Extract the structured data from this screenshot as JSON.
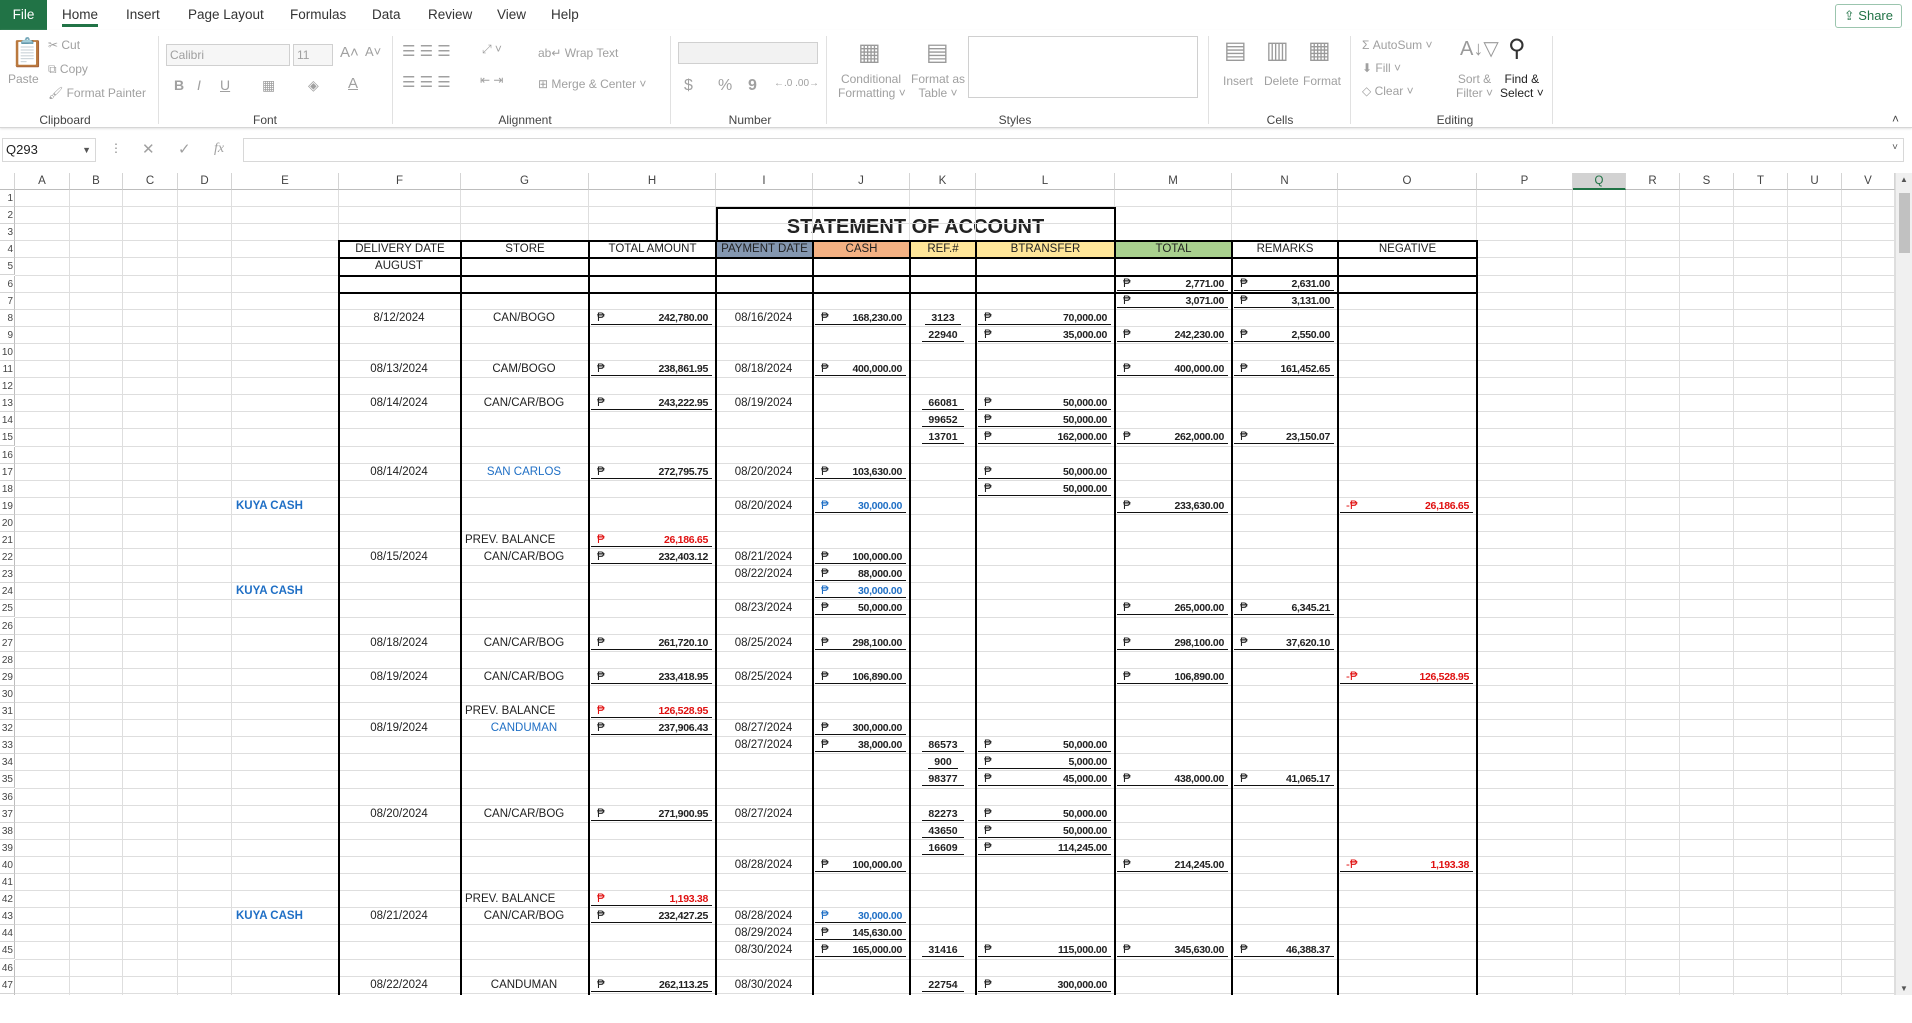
{
  "tabs": {
    "file": "File",
    "items": [
      "Home",
      "Insert",
      "Page Layout",
      "Formulas",
      "Data",
      "Review",
      "View",
      "Help"
    ],
    "active": "Home",
    "share": "Share"
  },
  "ribbon": {
    "clipboard": {
      "paste": "Paste",
      "cut": "Cut",
      "copy": "Copy",
      "format_painter": "Format Painter",
      "label": "Clipboard"
    },
    "font": {
      "name": "Calibri",
      "size": "11",
      "bold": "B",
      "italic": "I",
      "underline": "U",
      "label": "Font"
    },
    "alignment": {
      "wrap": "Wrap Text",
      "merge": "Merge & Center",
      "label": "Alignment"
    },
    "number": {
      "label": "Number",
      "dollar": "$",
      "percent": "%",
      "comma": "9"
    },
    "styles": {
      "conditional": "Conditional",
      "conditional2": "Formatting",
      "format_table": "Format as",
      "format_table2": "Table",
      "label": "Styles"
    },
    "cells": {
      "insert": "Insert",
      "delete": "Delete",
      "format": "Format",
      "label": "Cells"
    },
    "editing": {
      "autosum": "AutoSum",
      "fill": "Fill",
      "clear": "Clear",
      "sort": "Sort &",
      "sort2": "Filter",
      "find": "Find &",
      "find2": "Select",
      "label": "Editing"
    }
  },
  "formula_bar": {
    "name_box": "Q293",
    "fx": "fx",
    "value": ""
  },
  "sheet": {
    "selected_column": "Q",
    "columns": [
      "A",
      "B",
      "C",
      "D",
      "E",
      "F",
      "G",
      "H",
      "I",
      "J",
      "K",
      "L",
      "M",
      "N",
      "O",
      "P",
      "Q",
      "R",
      "S",
      "T",
      "U",
      "V"
    ],
    "title": "STATEMENT OF ACCOUNT",
    "headers": {
      "F": "DELIVERY DATE",
      "G": "STORE",
      "H": "TOTAL AMOUNT",
      "I": "PAYMENT DATE",
      "J": "CASH",
      "K": "REF.#",
      "L": "BTRANSFER",
      "M": "TOTAL",
      "N": "REMARKS",
      "O": "NEGATIVE"
    },
    "header_colors": {
      "I": "#8497b0",
      "J": "#f4b183",
      "K": "#ffe699",
      "L": "#ffe699",
      "M": "#a9d08e"
    },
    "rows": [
      {
        "row": 5,
        "cells": {
          "F": "AUGUST"
        }
      },
      {
        "row": 6,
        "cells": {
          "M": {
            "cur": "₱",
            "amt": "2,771.00"
          },
          "N": {
            "cur": "₱",
            "amt": "2,631.00"
          }
        }
      },
      {
        "row": 7,
        "cells": {
          "M": {
            "cur": "₱",
            "amt": "3,071.00"
          },
          "N": {
            "cur": "₱",
            "amt": "3,131.00"
          }
        }
      },
      {
        "row": 8,
        "cells": {
          "F": "8/12/2024",
          "G": "CAN/BOGO",
          "H": {
            "cur": "₱",
            "amt": "242,780.00"
          },
          "I": "08/16/2024",
          "J": {
            "cur": "₱",
            "amt": "168,230.00"
          },
          "K": {
            "ref": "3123"
          },
          "L": {
            "cur": "₱",
            "amt": "70,000.00"
          }
        }
      },
      {
        "row": 9,
        "cells": {
          "K": {
            "ref": "22940"
          },
          "L": {
            "cur": "₱",
            "amt": "35,000.00"
          },
          "M": {
            "cur": "₱",
            "amt": "242,230.00"
          },
          "N": {
            "cur": "₱",
            "amt": "2,550.00"
          }
        }
      },
      {
        "row": 11,
        "cells": {
          "F": "08/13/2024",
          "G": "CAM/BOGO",
          "H": {
            "cur": "₱",
            "amt": "238,861.95"
          },
          "I": "08/18/2024",
          "J": {
            "cur": "₱",
            "amt": "400,000.00"
          },
          "M": {
            "cur": "₱",
            "amt": "400,000.00"
          },
          "N": {
            "cur": "₱",
            "amt": "161,452.65"
          }
        }
      },
      {
        "row": 13,
        "cells": {
          "F": "08/14/2024",
          "G": "CAN/CAR/BOG",
          "H": {
            "cur": "₱",
            "amt": "243,222.95"
          },
          "I": "08/19/2024",
          "K": {
            "ref": "66081"
          },
          "L": {
            "cur": "₱",
            "amt": "50,000.00"
          }
        }
      },
      {
        "row": 14,
        "cells": {
          "K": {
            "ref": "99652"
          },
          "L": {
            "cur": "₱",
            "amt": "50,000.00"
          }
        }
      },
      {
        "row": 15,
        "cells": {
          "K": {
            "ref": "13701"
          },
          "L": {
            "cur": "₱",
            "amt": "162,000.00"
          },
          "M": {
            "cur": "₱",
            "amt": "262,000.00"
          },
          "N": {
            "cur": "₱",
            "amt": "23,150.07"
          }
        }
      },
      {
        "row": 17,
        "cells": {
          "F": "08/14/2024",
          "G": {
            "text": "SAN CARLOS",
            "color": "blue"
          },
          "H": {
            "cur": "₱",
            "amt": "272,795.75"
          },
          "I": "08/20/2024",
          "J": {
            "cur": "₱",
            "amt": "103,630.00"
          },
          "L": {
            "cur": "₱",
            "amt": "50,000.00"
          }
        }
      },
      {
        "row": 18,
        "cells": {
          "L": {
            "cur": "₱",
            "amt": "50,000.00"
          }
        }
      },
      {
        "row": 19,
        "cells": {
          "E": {
            "text": "KUYA CASH",
            "color": "blue",
            "align": "left"
          },
          "I": "08/20/2024",
          "J": {
            "cur": "₱",
            "amt": "30,000.00",
            "color": "blue"
          },
          "M": {
            "cur": "₱",
            "amt": "233,630.00"
          },
          "O": {
            "cur": "-₱",
            "amt": "26,186.65",
            "color": "red"
          }
        }
      },
      {
        "row": 21,
        "cells": {
          "G": {
            "text": "PREV. BALANCE",
            "align": "left"
          },
          "H": {
            "cur": "₱",
            "amt": "26,186.65",
            "color": "red"
          }
        }
      },
      {
        "row": 22,
        "cells": {
          "F": "08/15/2024",
          "G": "CAN/CAR/BOG",
          "H": {
            "cur": "₱",
            "amt": "232,403.12"
          },
          "I": "08/21/2024",
          "J": {
            "cur": "₱",
            "amt": "100,000.00"
          }
        }
      },
      {
        "row": 23,
        "cells": {
          "I": "08/22/2024",
          "J": {
            "cur": "₱",
            "amt": "88,000.00"
          }
        }
      },
      {
        "row": 24,
        "cells": {
          "E": {
            "text": "KUYA CASH",
            "color": "blue",
            "align": "left"
          },
          "J": {
            "cur": "₱",
            "amt": "30,000.00",
            "color": "blue"
          }
        }
      },
      {
        "row": 25,
        "cells": {
          "I": "08/23/2024",
          "J": {
            "cur": "₱",
            "amt": "50,000.00"
          },
          "M": {
            "cur": "₱",
            "amt": "265,000.00"
          },
          "N": {
            "cur": "₱",
            "amt": "6,345.21"
          }
        }
      },
      {
        "row": 27,
        "cells": {
          "F": "08/18/2024",
          "G": "CAN/CAR/BOG",
          "H": {
            "cur": "₱",
            "amt": "261,720.10"
          },
          "I": "08/25/2024",
          "J": {
            "cur": "₱",
            "amt": "298,100.00"
          },
          "M": {
            "cur": "₱",
            "amt": "298,100.00"
          },
          "N": {
            "cur": "₱",
            "amt": "37,620.10"
          }
        }
      },
      {
        "row": 29,
        "cells": {
          "F": "08/19/2024",
          "G": "CAN/CAR/BOG",
          "H": {
            "cur": "₱",
            "amt": "233,418.95"
          },
          "I": "08/25/2024",
          "J": {
            "cur": "₱",
            "amt": "106,890.00"
          },
          "M": {
            "cur": "₱",
            "amt": "106,890.00"
          },
          "O": {
            "cur": "-₱",
            "amt": "126,528.95",
            "color": "red"
          }
        }
      },
      {
        "row": 31,
        "cells": {
          "G": {
            "text": "PREV. BALANCE",
            "align": "left"
          },
          "H": {
            "cur": "₱",
            "amt": "126,528.95",
            "color": "red"
          }
        }
      },
      {
        "row": 32,
        "cells": {
          "F": "08/19/2024",
          "G": {
            "text": "CANDUMAN",
            "color": "blue"
          },
          "H": {
            "cur": "₱",
            "amt": "237,906.43"
          },
          "I": "08/27/2024",
          "J": {
            "cur": "₱",
            "amt": "300,000.00"
          }
        }
      },
      {
        "row": 33,
        "cells": {
          "I": "08/27/2024",
          "J": {
            "cur": "₱",
            "amt": "38,000.00"
          },
          "K": {
            "ref": "86573"
          },
          "L": {
            "cur": "₱",
            "amt": "50,000.00"
          }
        }
      },
      {
        "row": 34,
        "cells": {
          "K": {
            "ref": "900"
          },
          "L": {
            "cur": "₱",
            "amt": "5,000.00"
          }
        }
      },
      {
        "row": 35,
        "cells": {
          "K": {
            "ref": "98377"
          },
          "L": {
            "cur": "₱",
            "amt": "45,000.00"
          },
          "M": {
            "cur": "₱",
            "amt": "438,000.00"
          },
          "N": {
            "cur": "₱",
            "amt": "41,065.17"
          }
        }
      },
      {
        "row": 37,
        "cells": {
          "F": "08/20/2024",
          "G": "CAN/CAR/BOG",
          "H": {
            "cur": "₱",
            "amt": "271,900.95"
          },
          "I": "08/27/2024",
          "K": {
            "ref": "82273"
          },
          "L": {
            "cur": "₱",
            "amt": "50,000.00"
          }
        }
      },
      {
        "row": 38,
        "cells": {
          "K": {
            "ref": "43650"
          },
          "L": {
            "cur": "₱",
            "amt": "50,000.00"
          }
        }
      },
      {
        "row": 39,
        "cells": {
          "K": {
            "ref": "16609"
          },
          "L": {
            "cur": "₱",
            "amt": "114,245.00"
          }
        }
      },
      {
        "row": 40,
        "cells": {
          "I": "08/28/2024",
          "J": {
            "cur": "₱",
            "amt": "100,000.00"
          },
          "M": {
            "cur": "₱",
            "amt": "214,245.00"
          },
          "O": {
            "cur": "-₱",
            "amt": "1,193.38",
            "color": "red"
          }
        }
      },
      {
        "row": 42,
        "cells": {
          "G": {
            "text": "PREV. BALANCE",
            "align": "left"
          },
          "H": {
            "cur": "₱",
            "amt": "1,193.38",
            "color": "red"
          }
        }
      },
      {
        "row": 43,
        "cells": {
          "E": {
            "text": "KUYA CASH",
            "color": "blue",
            "align": "left"
          },
          "F": "08/21/2024",
          "G": "CAN/CAR/BOG",
          "H": {
            "cur": "₱",
            "amt": "232,427.25"
          },
          "I": "08/28/2024",
          "J": {
            "cur": "₱",
            "amt": "30,000.00",
            "color": "blue"
          }
        }
      },
      {
        "row": 44,
        "cells": {
          "I": "08/29/2024",
          "J": {
            "cur": "₱",
            "amt": "145,630.00"
          }
        }
      },
      {
        "row": 45,
        "cells": {
          "I": "08/30/2024",
          "J": {
            "cur": "₱",
            "amt": "165,000.00"
          },
          "K": {
            "ref": "31416"
          },
          "L": {
            "cur": "₱",
            "amt": "115,000.00"
          },
          "M": {
            "cur": "₱",
            "amt": "345,630.00"
          },
          "N": {
            "cur": "₱",
            "amt": "46,388.37"
          }
        }
      },
      {
        "row": 47,
        "cells": {
          "F": "08/22/2024",
          "G": "CANDUMAN",
          "H": {
            "cur": "₱",
            "amt": "262,113.25"
          },
          "I": "08/30/2024",
          "K": {
            "ref": "22754"
          },
          "L": {
            "cur": "₱",
            "amt": "300,000.00"
          }
        }
      }
    ]
  }
}
